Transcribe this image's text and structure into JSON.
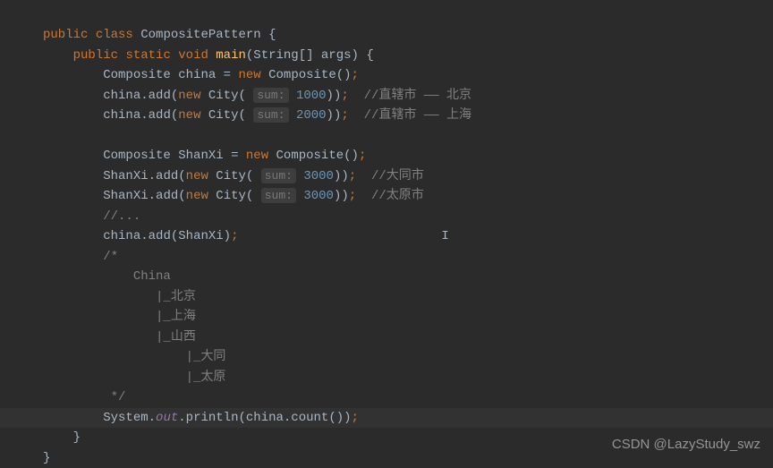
{
  "code": {
    "l1": {
      "kw1": "public",
      "kw2": "class",
      "cls": "CompositePattern",
      "br": "{"
    },
    "l2": {
      "kw1": "public",
      "kw2": "static",
      "kw3": "void",
      "fn": "main",
      "params": "(String[] args)",
      "br": "{"
    },
    "l3": {
      "type": "Composite",
      "var": "china",
      "eq": "=",
      "kw": "new",
      "ctor": "Composite()",
      "sc": ";"
    },
    "l4": {
      "var": "china",
      "dot": ".",
      "fn": "add",
      "p1": "(",
      "kw": "new",
      "ctor": "City",
      "p2": "(",
      "hint": "sum:",
      "num": "1000",
      "p3": "))",
      "sc": ";",
      "cm": "  //直辖市 —— 北京"
    },
    "l5": {
      "var": "china",
      "dot": ".",
      "fn": "add",
      "p1": "(",
      "kw": "new",
      "ctor": "City",
      "p2": "(",
      "hint": "sum:",
      "num": "2000",
      "p3": "))",
      "sc": ";",
      "cm": "  //直辖市 —— 上海"
    },
    "l6": {
      "blank": ""
    },
    "l7": {
      "type": "Composite",
      "var": "ShanXi",
      "eq": "=",
      "kw": "new",
      "ctor": "Composite()",
      "sc": ";"
    },
    "l8": {
      "var": "ShanXi",
      "dot": ".",
      "fn": "add",
      "p1": "(",
      "kw": "new",
      "ctor": "City",
      "p2": "(",
      "hint": "sum:",
      "num": "3000",
      "p3": "))",
      "sc": ";",
      "cm": "  //大同市"
    },
    "l9": {
      "var": "ShanXi",
      "dot": ".",
      "fn": "add",
      "p1": "(",
      "kw": "new",
      "ctor": "City",
      "p2": "(",
      "hint": "sum:",
      "num": "3000",
      "p3": "))",
      "sc": ";",
      "cm": "  //太原市"
    },
    "l10": {
      "cm": "//..."
    },
    "l11": {
      "var": "china",
      "dot": ".",
      "fn": "add",
      "p1": "(ShanXi)",
      "sc": ";"
    },
    "l12": {
      "cm": "/*"
    },
    "l13": {
      "cm": "    China"
    },
    "l14": {
      "cm": "       |_北京"
    },
    "l15": {
      "cm": "       |_上海"
    },
    "l16": {
      "cm": "       |_山西"
    },
    "l17": {
      "cm": "           |_大同"
    },
    "l18": {
      "cm": "           |_太原"
    },
    "l19": {
      "cm": " */"
    },
    "l20": {
      "cls": "System",
      "dot1": ".",
      "fld": "out",
      "dot2": ".",
      "fn": "println",
      "p1": "(china.",
      "m": "count",
      "p2": "())",
      "sc": ";"
    },
    "l21": {
      "br": "}"
    },
    "l22": {
      "br": "}"
    }
  },
  "watermark": "CSDN @LazyStudy_swz"
}
